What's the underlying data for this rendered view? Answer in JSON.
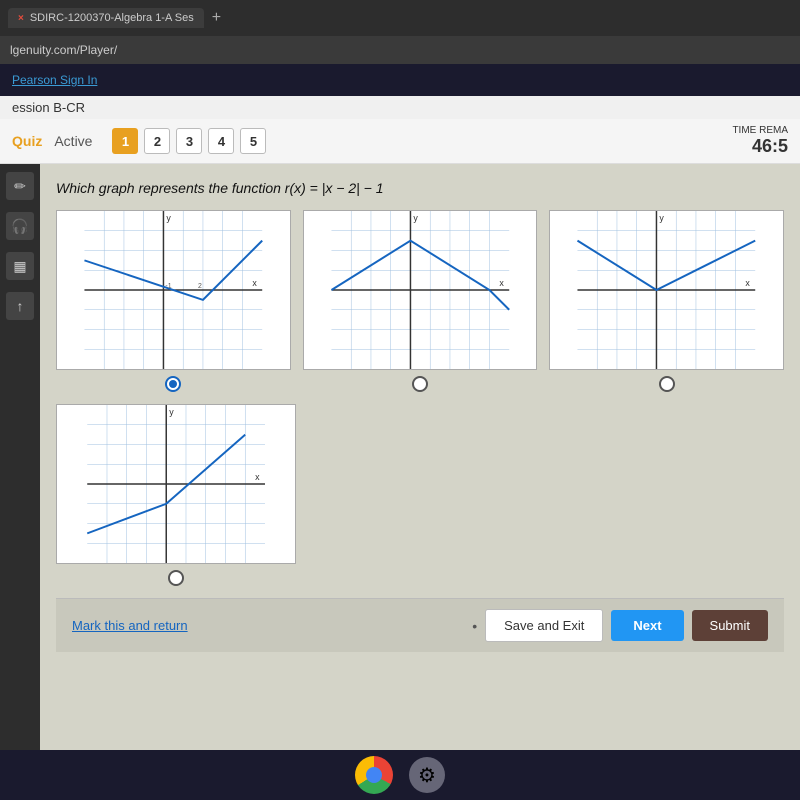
{
  "browser": {
    "tab_title": "SDIRC-1200370-Algebra 1-A Ses",
    "url": "lgenuity.com/Player/",
    "tab_close": "×",
    "tab_plus": "+"
  },
  "nav": {
    "pearson": "Pearson Sign In",
    "session": "ession B-CR"
  },
  "quiz": {
    "label": "Quiz",
    "status": "Active",
    "questions": [
      "1",
      "2",
      "3",
      "4",
      "5"
    ],
    "time_label": "TIME REMA",
    "time_value": "46:5"
  },
  "question": {
    "text": "Which graph represents the function r(x) = |x − 2| − 1"
  },
  "footer": {
    "mark_return": "Mark this and return",
    "save_exit": "Save and Exit",
    "next": "Next",
    "submit": "Submit"
  },
  "graphs": [
    {
      "id": "graph-1",
      "selected": true
    },
    {
      "id": "graph-2",
      "selected": false
    },
    {
      "id": "graph-3",
      "selected": false
    },
    {
      "id": "graph-4",
      "selected": false
    }
  ],
  "sidebar_icons": [
    "✏️",
    "🎧",
    "📊",
    "⬆"
  ]
}
